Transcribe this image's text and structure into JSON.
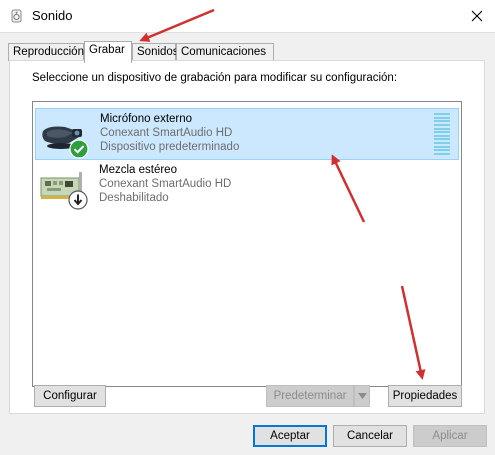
{
  "window": {
    "title": "Sonido"
  },
  "tabs": [
    {
      "label": "Reproducción",
      "active": false
    },
    {
      "label": "Grabar",
      "active": true
    },
    {
      "label": "Sonidos",
      "active": false
    },
    {
      "label": "Comunicaciones",
      "active": false
    }
  ],
  "instruction": "Seleccione un dispositivo de grabación para modificar su configuración:",
  "devices": [
    {
      "name": "Micrófono externo",
      "driver": "Conexant SmartAudio HD",
      "status": "Dispositivo predeterminado",
      "selected": true,
      "badge": "check-icon"
    },
    {
      "name": "Mezcla estéreo",
      "driver": "Conexant SmartAudio HD",
      "status": "Deshabilitado",
      "selected": false,
      "badge": "down-arrow-icon"
    }
  ],
  "panel_buttons": {
    "configure": "Configurar",
    "set_default": "Predeterminar",
    "properties": "Propiedades"
  },
  "dialog_buttons": {
    "ok": "Aceptar",
    "cancel": "Cancelar",
    "apply": "Aplicar"
  },
  "colors": {
    "selection_bg": "#cce8ff",
    "selection_border": "#99d1ff",
    "annotation_arrow": "#d32f2f",
    "check_badge": "#2e9e3e",
    "default_button_border": "#0078d7"
  }
}
